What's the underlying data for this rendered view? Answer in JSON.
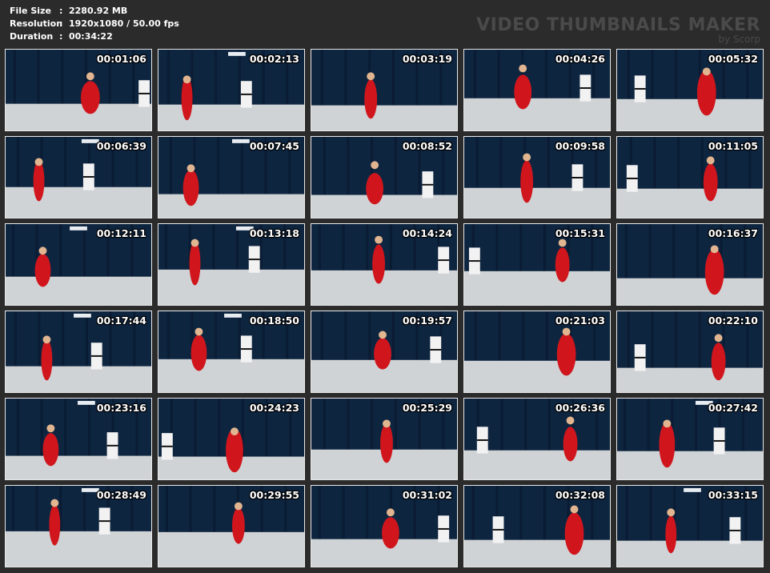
{
  "meta": {
    "file_size_label": "File Size",
    "file_size_value": "2280.92 MB",
    "resolution_label": "Resolution",
    "resolution_value": "1920x1080 / 50.00 fps",
    "duration_label": "Duration",
    "duration_value": "00:34:22",
    "separator": ":"
  },
  "brand": {
    "title": "VIDEO THUMBNAILS MAKER",
    "subtitle": "by Scorp"
  },
  "thumbnails": [
    "00:01:06",
    "00:02:13",
    "00:03:19",
    "00:04:26",
    "00:05:32",
    "00:06:39",
    "00:07:45",
    "00:08:52",
    "00:09:58",
    "00:11:05",
    "00:12:11",
    "00:13:18",
    "00:14:24",
    "00:15:31",
    "00:16:37",
    "00:17:44",
    "00:18:50",
    "00:19:57",
    "00:21:03",
    "00:22:10",
    "00:23:16",
    "00:24:23",
    "00:25:29",
    "00:26:36",
    "00:27:42",
    "00:28:49",
    "00:29:55",
    "00:31:02",
    "00:32:08",
    "00:33:15"
  ],
  "colors": {
    "background": "#2b2b2b",
    "wall": "#0e2540",
    "floor": "#cfd3d6",
    "outfit_red": "#d0161c",
    "uniform_white": "#f2f2f2"
  }
}
